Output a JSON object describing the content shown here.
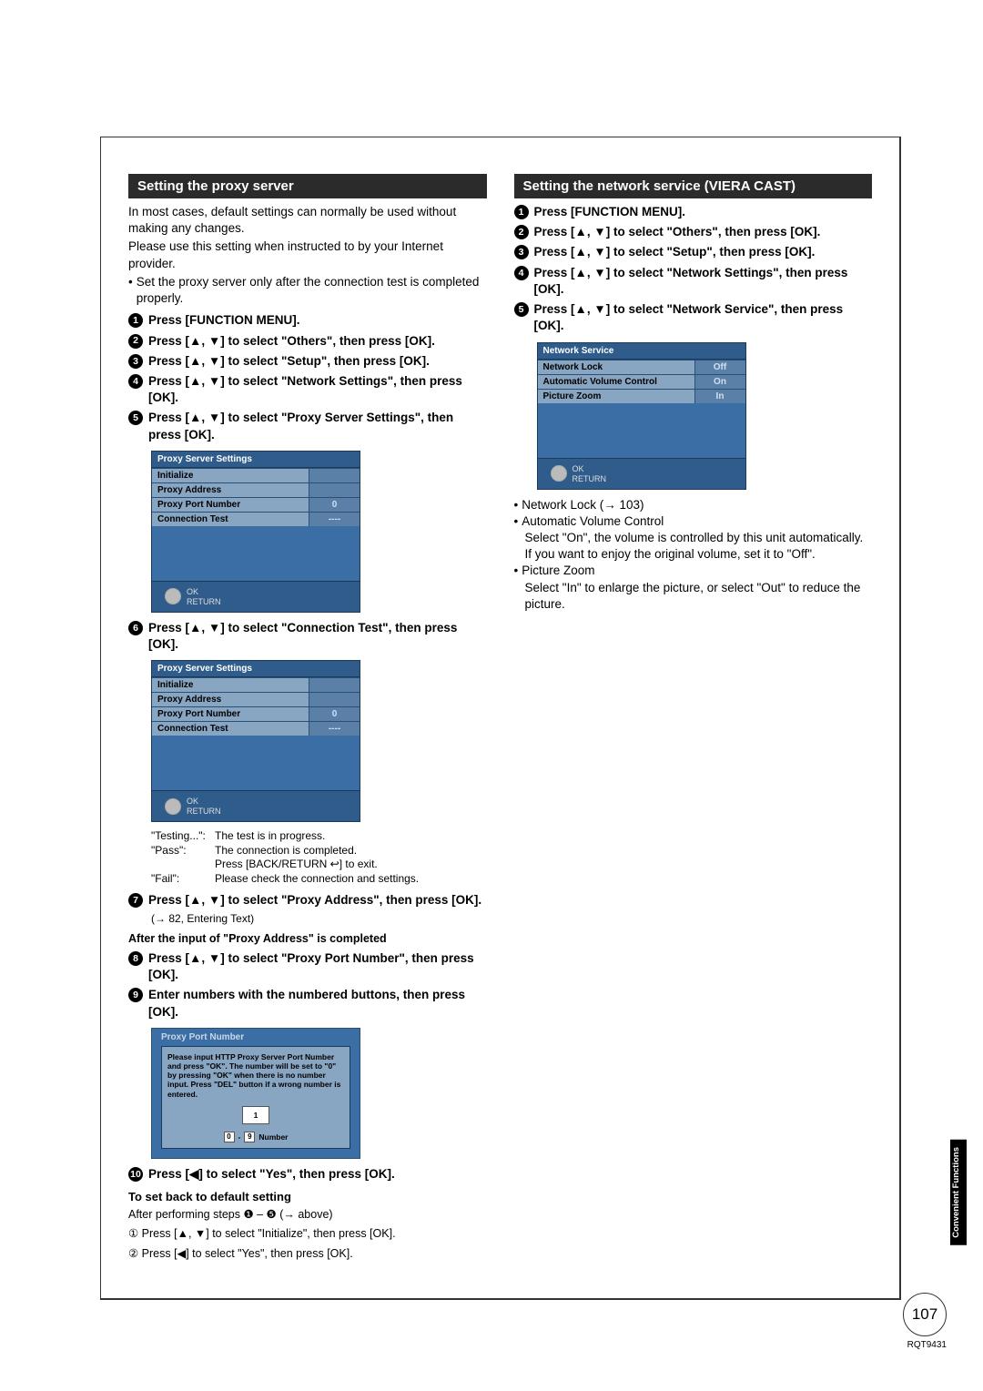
{
  "left": {
    "section_title": "Setting the proxy server",
    "intro1": "In most cases, default settings can normally be used without making any changes.",
    "intro2": "Please use this setting when instructed to by your Internet provider.",
    "intro_bullet": "Set the proxy server only after the connection test is completed properly.",
    "steps_a": [
      "Press [FUNCTION MENU].",
      "Press [▲, ▼] to select \"Others\", then press [OK].",
      "Press [▲, ▼] to select \"Setup\", then press [OK].",
      "Press [▲, ▼] to select \"Network Settings\", then press [OK].",
      "Press [▲, ▼] to select \"Proxy Server Settings\", then press [OK]."
    ],
    "osd1_title": "Proxy Server Settings",
    "osd_rows": [
      {
        "lbl": "Initialize",
        "val": ""
      },
      {
        "lbl": "Proxy Address",
        "val": ""
      },
      {
        "lbl": "Proxy Port Number",
        "val": "0"
      },
      {
        "lbl": "Connection Test",
        "val": "----"
      }
    ],
    "osd_ok": "OK",
    "osd_return": "RETURN",
    "step6": "Press [▲, ▼] to select \"Connection Test\", then press [OK].",
    "testing_lines": [
      [
        "\"Testing...\":",
        "The test is in progress."
      ],
      [
        "\"Pass\":",
        "The connection is completed."
      ],
      [
        "",
        "Press [BACK/RETURN ↩] to exit."
      ],
      [
        "\"Fail\":",
        "Please check the connection and settings."
      ]
    ],
    "step7": "Press [▲, ▼] to select \"Proxy Address\", then press [OK].",
    "step7_sub": "(→ 82, Entering Text)",
    "after_label": "After the input of \"Proxy Address\" is completed",
    "step8": "Press [▲, ▼] to select \"Proxy Port Number\", then press [OK].",
    "step9": "Enter numbers with the numbered buttons, then press [OK].",
    "ppn_title": "Proxy Port Number",
    "ppn_text": "Please input HTTP Proxy Server Port Number and press \"OK\". The number will be set to \"0\" by pressing \"OK\" when there is no number input. Press \"DEL\" button if a wrong number is entered.",
    "ppn_input": "1",
    "ppn_k0": "0",
    "ppn_dash": "-",
    "ppn_k9": "9",
    "ppn_number": "Number",
    "step10": "Press [◀] to select \"Yes\", then press [OK].",
    "reset_heading": "To set back to default setting",
    "reset_after": "After performing steps ❶ – ❺ (→ above)",
    "reset_line1": "① Press [▲, ▼] to select \"Initialize\", then press [OK].",
    "reset_line2": "② Press [◀] to select \"Yes\", then press [OK]."
  },
  "right": {
    "section_title": "Setting the network service (VIERA CAST)",
    "steps": [
      "Press [FUNCTION MENU].",
      "Press [▲, ▼] to select \"Others\", then press [OK].",
      "Press [▲, ▼] to select \"Setup\", then press [OK].",
      "Press [▲, ▼] to select \"Network Settings\", then press [OK].",
      "Press [▲, ▼] to select \"Network Service\", then press [OK]."
    ],
    "osd_title": "Network Service",
    "osd_rows": [
      {
        "lbl": "Network Lock",
        "val": "Off"
      },
      {
        "lbl": "Automatic Volume Control",
        "val": "On"
      },
      {
        "lbl": "Picture Zoom",
        "val": "In"
      }
    ],
    "notes": {
      "nl": "Network Lock (→ 103)",
      "avc_t": "Automatic Volume Control",
      "avc_b": "Select \"On\", the volume is controlled by this unit automatically. If you want to enjoy the original volume, set it to \"Off\".",
      "pz_t": "Picture Zoom",
      "pz_b": "Select \"In\" to enlarge the picture, or select  \"Out\" to reduce the picture."
    }
  },
  "side_tab": "Convenient\nFunctions",
  "page_number": "107",
  "footer_code": "RQT9431"
}
